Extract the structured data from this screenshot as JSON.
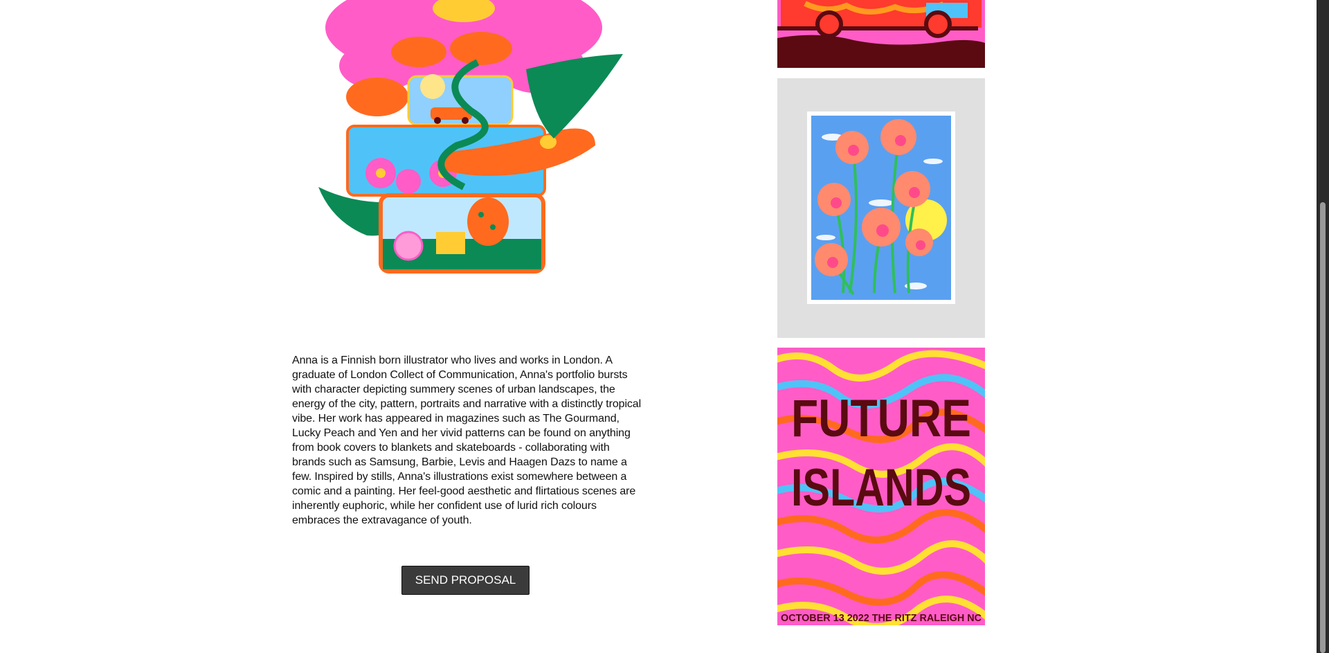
{
  "bio": {
    "text": "Anna is a Finnish born illustrator who lives and works in London. A graduate of London Collect of Communication, Anna's portfolio bursts with character depicting summery scenes of urban landscapes, the energy of the city, pattern, portraits and narrative with a distinctly tropical vibe. Her work has appeared in magazines such as The Gourmand, Lucky Peach and Yen and her vivid patterns can be found on anything from book covers to blankets and skateboards - collaborating with brands such as Samsung, Barbie, Levis and Haagen Dazs to name a few. Inspired by stills, Anna's illustrations exist somewhere between a comic and a painting. Her feel-good aesthetic and flirtatious scenes are inherently euphoric, while her confident use of lurid rich colours embraces the extravagance of youth."
  },
  "actions": {
    "send_proposal_label": "SEND PROPOSAL"
  },
  "gallery": {
    "poster": {
      "title_line1": "FUTURE",
      "title_line2": "ISLANDS",
      "footer": "OCTOBER 13 2022   THE RITZ RALEIGH NC"
    }
  },
  "colors": {
    "button_bg": "#3b3b3b",
    "pink": "#ff5cc8",
    "orange": "#ff6a1f",
    "green": "#0b8a55",
    "sky": "#5aa0f0",
    "maroon": "#5a0a10",
    "scrollbar_track": "#2b2b2b",
    "scrollbar_thumb": "#9a9a9a"
  }
}
